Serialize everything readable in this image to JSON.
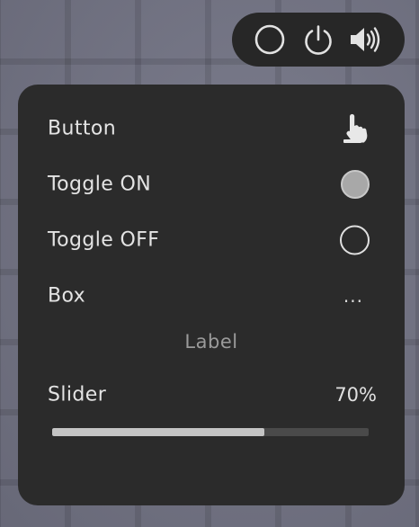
{
  "topbar": {
    "icons": [
      "circle-icon",
      "power-icon",
      "volume-icon"
    ]
  },
  "menu": {
    "button": {
      "label": "Button",
      "icon": "hand-pointer-icon"
    },
    "toggle_on": {
      "label": "Toggle ON",
      "state": true
    },
    "toggle_off": {
      "label": "Toggle OFF",
      "state": false
    },
    "box": {
      "label": "Box",
      "value": "..."
    },
    "label_text": "Label",
    "slider": {
      "label": "Slider",
      "value_text": "70%",
      "value": 0.67
    }
  },
  "colors": {
    "panel": "#2b2b2b",
    "pill": "#272727",
    "text": "#e4e4e4",
    "muted": "#9a9a9a",
    "slider_fill": "#c4c4c4",
    "slider_track": "#4a4a4a"
  }
}
